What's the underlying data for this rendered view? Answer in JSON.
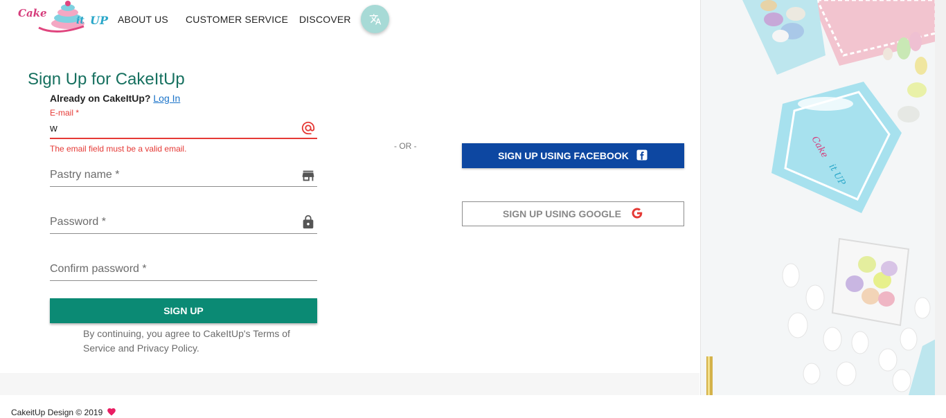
{
  "logo": {
    "cake": "Cake",
    "it": "it",
    "up": "UP"
  },
  "nav": {
    "items": [
      {
        "label": "ABOUT US"
      },
      {
        "label": "CUSTOMER SERVICE"
      },
      {
        "label": "DISCOVER"
      }
    ]
  },
  "form": {
    "title": "Sign Up for CakeItUp",
    "already_text": "Already on CakeItUp?",
    "login_link": "Log In",
    "email": {
      "label": "E-mail *",
      "value": "w",
      "error": "The email field must be a valid email."
    },
    "pastry": {
      "placeholder": "Pastry name *"
    },
    "password": {
      "placeholder": "Password *"
    },
    "confirm": {
      "placeholder": "Confirm password *"
    },
    "submit_label": "SIGN UP",
    "terms": "By continuing, you agree to CakeItUp's Terms of Service and Privacy Policy."
  },
  "divider": "- OR -",
  "social": {
    "facebook_label": "SIGN UP USING FACEBOOK",
    "google_label": "SIGN UP USING GOOGLE"
  },
  "footer": {
    "text": "CakeitUp Design © 2019"
  },
  "colors": {
    "accent": "#0b8a74",
    "title": "#16705f",
    "error": "#e53935",
    "facebook": "#0d47a1",
    "translate": "#a7dad6"
  }
}
